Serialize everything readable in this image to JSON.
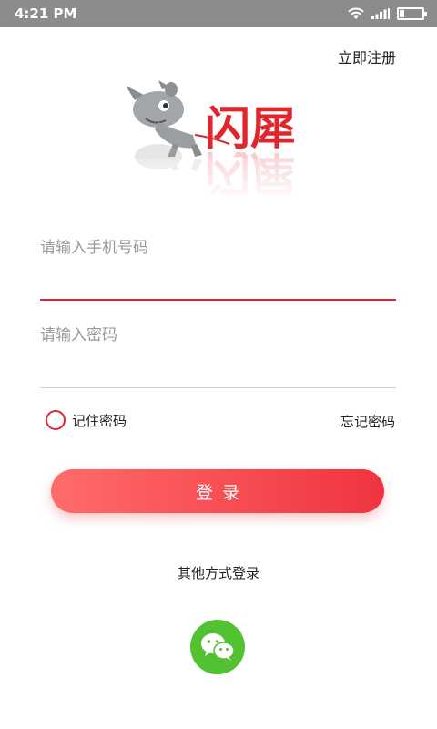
{
  "status_bar": {
    "time": "4:21 PM",
    "icons": [
      "wifi-icon",
      "signal-icon",
      "battery-icon"
    ],
    "battery_level_percent": 20
  },
  "header": {
    "register_label": "立即注册"
  },
  "logo": {
    "brand_text": "闪犀",
    "icon": "rhino-mascot-logo"
  },
  "form": {
    "phone_placeholder": "请输入手机号码",
    "password_placeholder": "请输入密码",
    "remember_label": "记住密码",
    "forgot_label": "忘记密码",
    "login_label": "登录"
  },
  "alternative": {
    "label": "其他方式登录",
    "wechat_icon": "wechat-icon"
  },
  "colors": {
    "accent": "#e02a33",
    "button_gradient_start": "#ff6b6b",
    "button_gradient_end": "#f0343f",
    "wechat_green": "#52c132",
    "status_bar": "#8c8c8c"
  }
}
